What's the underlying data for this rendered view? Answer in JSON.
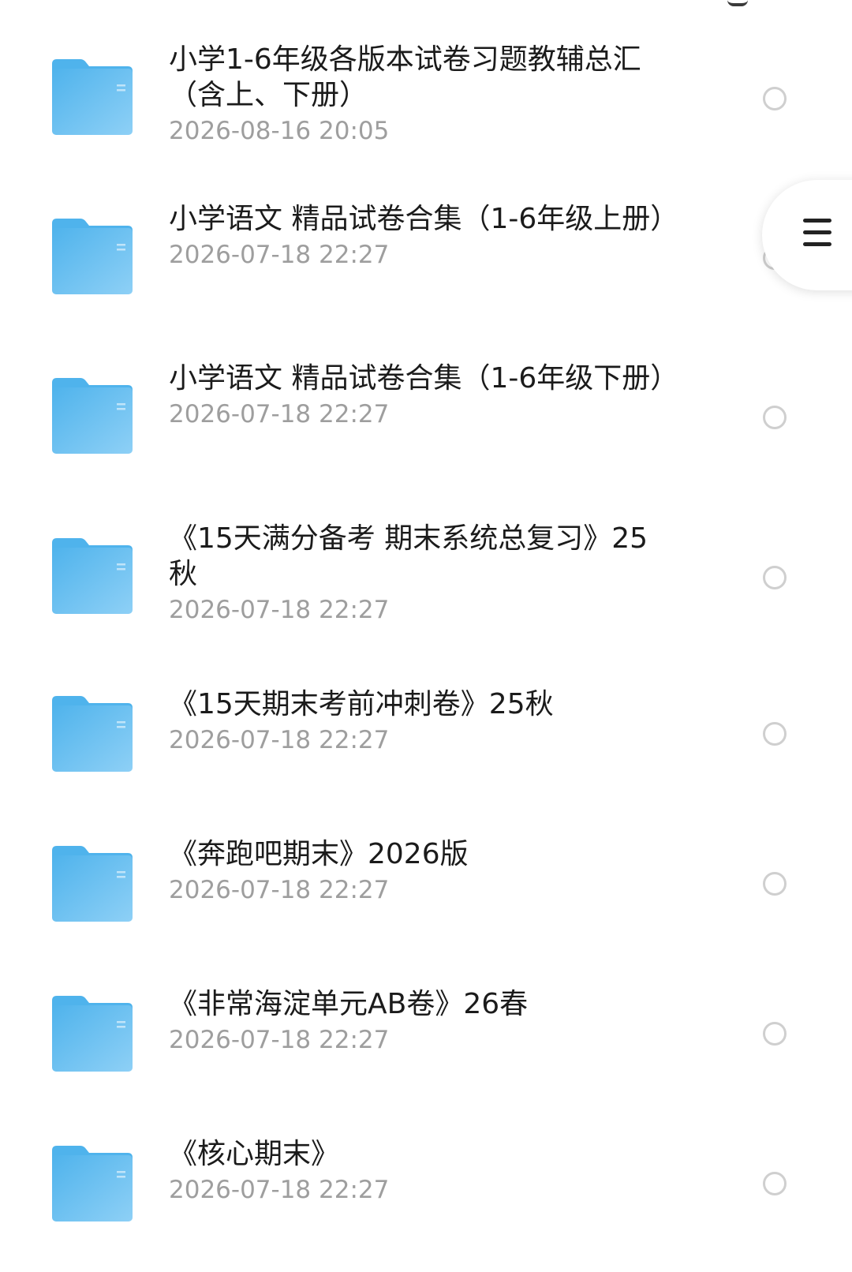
{
  "files": [
    {
      "title": "小学1-6年级各版本试卷习题教辅总汇（含上、下册）",
      "date": "2026-08-16 20:05",
      "icon": "folder-icon"
    },
    {
      "title": "小学语文 精品试卷合集（1-6年级上册）",
      "date": "2026-07-18 22:27",
      "icon": "folder-icon"
    },
    {
      "title": "小学语文 精品试卷合集（1-6年级下册）",
      "date": "2026-07-18 22:27",
      "icon": "folder-icon"
    },
    {
      "title": "《15天满分备考 期末系统总复习》25秋",
      "date": "2026-07-18 22:27",
      "icon": "folder-icon"
    },
    {
      "title": "《15天期末考前冲刺卷》25秋",
      "date": "2026-07-18 22:27",
      "icon": "folder-icon"
    },
    {
      "title": "《奔跑吧期末》2026版",
      "date": "2026-07-18 22:27",
      "icon": "folder-icon"
    },
    {
      "title": "《非常海淀单元AB卷》26春",
      "date": "2026-07-18 22:27",
      "icon": "folder-icon"
    },
    {
      "title": "《核心期末》",
      "date": "2026-07-18 22:27",
      "icon": "folder-icon"
    }
  ],
  "side_menu": {
    "icon": "menu-icon"
  },
  "colors": {
    "folder_light": "#8ed0f6",
    "folder_dark": "#4fb3ec",
    "title_text": "#1b1b1b",
    "date_text": "#9e9e9e",
    "radio_border": "#cfcfcf"
  }
}
